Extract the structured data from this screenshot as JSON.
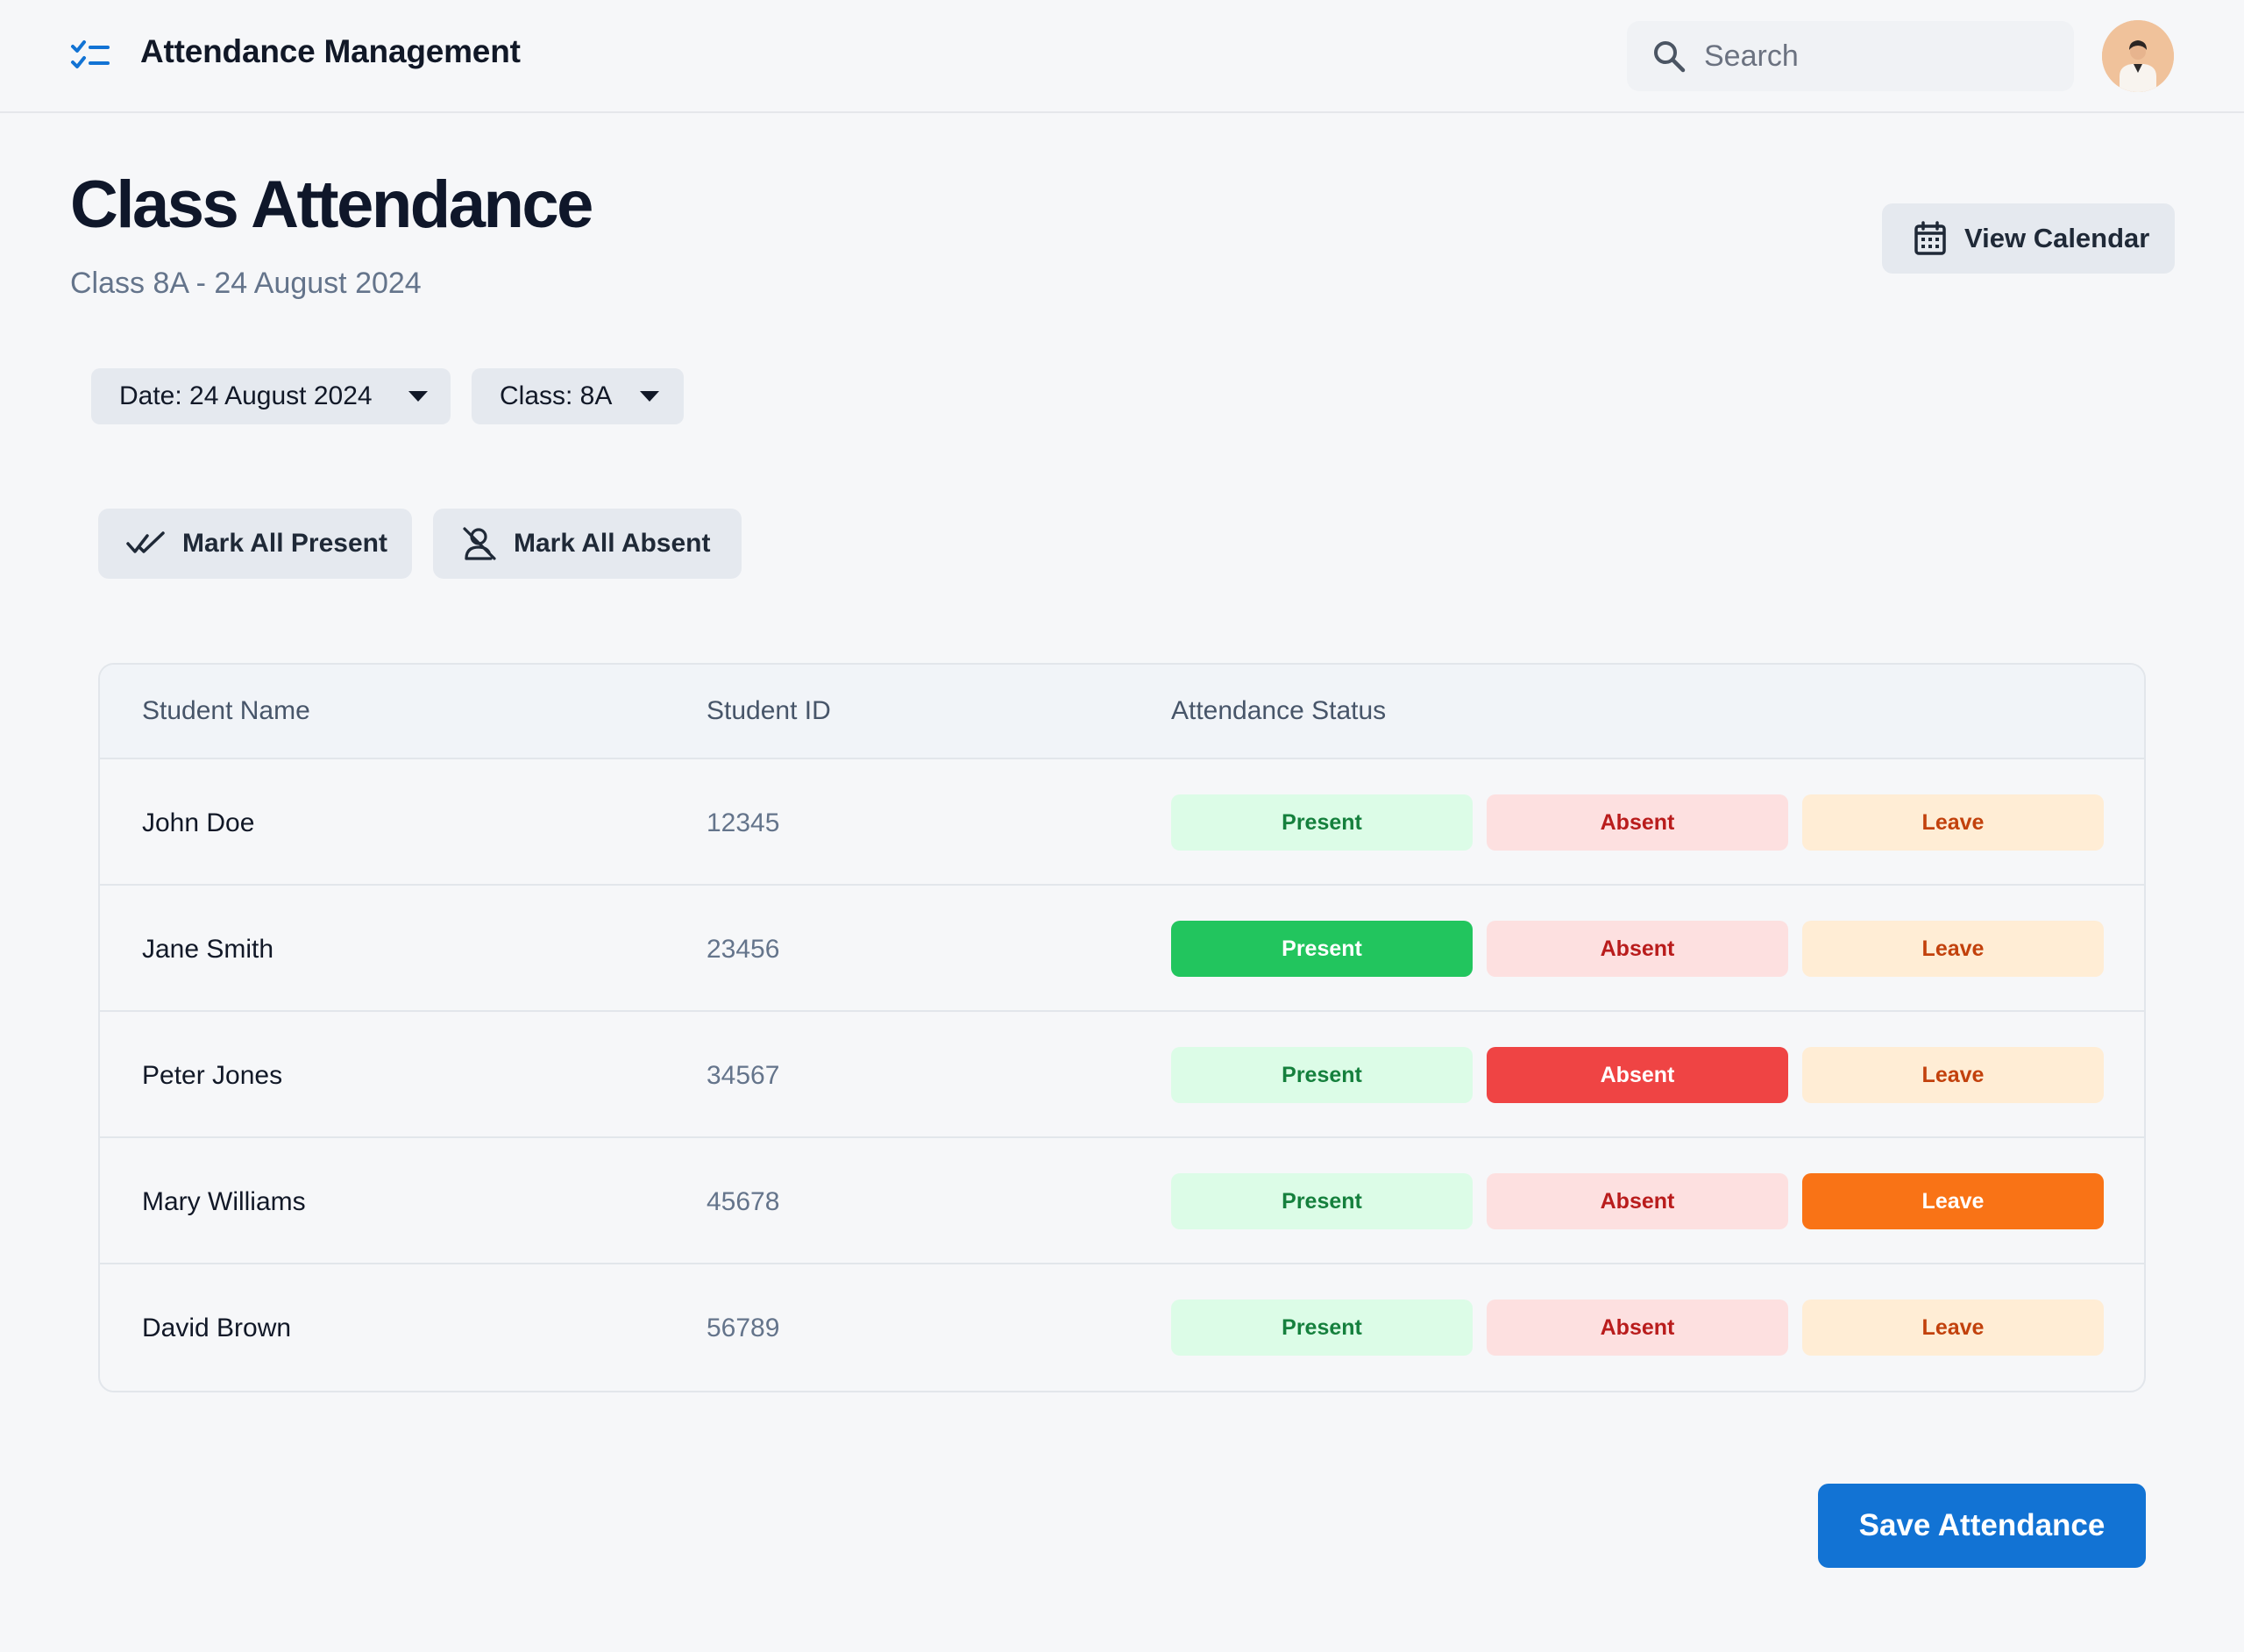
{
  "header": {
    "brand_icon": "checklist-icon",
    "title": "Attendance Management",
    "search": {
      "placeholder": "Search",
      "value": ""
    },
    "avatar_icon": "user-avatar"
  },
  "page": {
    "title": "Class Attendance",
    "subtitle": "Class 8A - 24 August 2024",
    "view_calendar_label": "View Calendar",
    "view_calendar_icon": "calendar-icon"
  },
  "filters": {
    "date_label": "Date: 24 August 2024",
    "class_label": "Class: 8A"
  },
  "bulk_actions": {
    "mark_all_present": "Mark All Present",
    "mark_all_absent": "Mark All Absent"
  },
  "table": {
    "columns": [
      "Student Name",
      "Student ID",
      "Attendance Status"
    ],
    "status_labels": {
      "present": "Present",
      "absent": "Absent",
      "leave": "Leave"
    },
    "rows": [
      {
        "name": "John Doe",
        "id": "12345",
        "status": ""
      },
      {
        "name": "Jane Smith",
        "id": "23456",
        "status": "present"
      },
      {
        "name": "Peter Jones",
        "id": "34567",
        "status": "absent"
      },
      {
        "name": "Mary Williams",
        "id": "45678",
        "status": "leave"
      },
      {
        "name": "David Brown",
        "id": "56789",
        "status": ""
      }
    ]
  },
  "footer": {
    "save_label": "Save Attendance"
  },
  "colors": {
    "accent": "#1273d4",
    "present_active": "#22c55e",
    "absent_active": "#ef4444",
    "leave_active": "#f97316"
  }
}
